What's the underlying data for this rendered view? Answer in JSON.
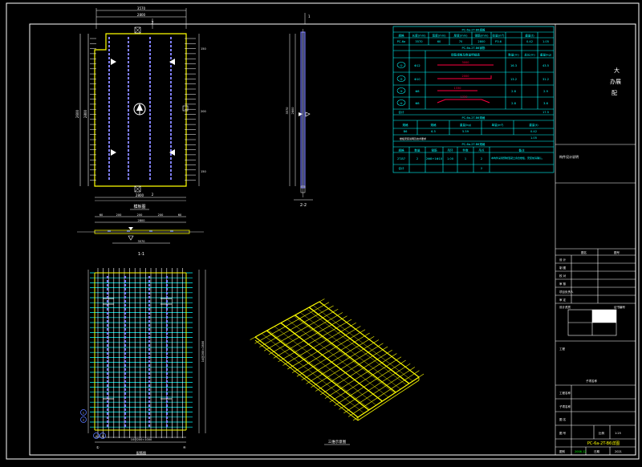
{
  "colors": {
    "background": "#000000",
    "frame": "#ffffff",
    "yellow": "#ffff00",
    "cyan": "#00ffff",
    "blue": "#5a78ff",
    "purple": "#8080ff",
    "red": "#ff0040",
    "magenta": "#ff00ff",
    "green": "#00ff00"
  },
  "table": {
    "title1": "PC-6a-2T-B6规格",
    "title2": "PC-6a-2T-B6钢筋",
    "title3": "PC-6a-2T-B6规格",
    "title4": "PC-6a-2T-B6规格",
    "header_row": [
      "规格",
      "长度(mm)",
      "宽度(mm)",
      "厚度(mm)",
      "钢筋(mm)",
      "砼量(m³)",
      "重量(t)"
    ],
    "spec_row": [
      "PC-6a",
      "3570",
      "60",
      "70",
      "2800",
      "P3.6",
      "0.42",
      "1.05"
    ],
    "rebar_header": "钢筋规格及数量明细表",
    "rebar_rows": [
      {
        "id": "①",
        "spec": "Φ12",
        "len": "3000",
        "n": "16.3",
        "w": "43.5"
      },
      {
        "id": "②",
        "spec": "Φ10",
        "len": "2000",
        "n": "13.2",
        "w": "31.2"
      },
      {
        "id": "③",
        "spec": "Φ8",
        "len": "1330",
        "n": "2.8",
        "w": "2.9"
      },
      {
        "id": "④",
        "spec": "Φ8",
        "len": "1330",
        "n": "2.8",
        "w": "3.6"
      }
    ],
    "sum_label": "合计",
    "sum_value": "17.5",
    "mid_row_labels": [
      "规格",
      "规格",
      "重量(kg)",
      "单量(m³)",
      "重量(t)"
    ],
    "mid_row_values": [
      "B6",
      "6.5",
      "5.59",
      "0.42"
    ],
    "mid_row_values2": [
      "",
      "",
      "",
      "1.05"
    ],
    "bottom_header": [
      "规格",
      "数量",
      "钢筋",
      "吊环",
      "件数",
      "吊点",
      "备注"
    ],
    "bottom_row": [
      "2T-B7",
      "2",
      "2Φ8+1Φ10",
      "1.00",
      "1",
      "2"
    ],
    "bottom_sum": [
      "合计",
      "",
      "",
      "",
      "",
      "2"
    ],
    "note_text": "本构件采用预制混凝土叠合楼板，安装前请确认。"
  },
  "side_note": "楼板安装说明及技术要求",
  "side_note2": "构件设计说明",
  "title_big": "大",
  "title_big2": "办展",
  "title_big3": "配",
  "title_block": {
    "rows": [
      "设 计",
      "制 图",
      "校 对",
      "审 核",
      "项目负责人",
      "审 定"
    ],
    "col_labels": [
      "图名",
      "图号"
    ],
    "company_label": "工程",
    "project_label": "子项名称",
    "scale_label": "比例",
    "scale_value": "1:25",
    "sheet_label": "图别",
    "date_label": "日期",
    "drawing_no": "PC-6a-2T-B6详图",
    "bottom_left": "2008.12",
    "bottom_right": "2021",
    "small_top": "设计资质",
    "small_top2": "证书编号"
  },
  "views": {
    "plan_label": "模板图",
    "section11": "1-1",
    "section22": "2-2",
    "rebar_label": "配筋图",
    "iso_label": "三维示意图",
    "dims_top": [
      "3570",
      "2800"
    ],
    "dims_bottom": [
      "2800",
      "3570"
    ],
    "dims_side_left": [
      "2600",
      "2800"
    ],
    "dims_mid": [
      "60",
      "200",
      "200",
      "200",
      "60"
    ],
    "dim_rebar_bottom": "10@200=1000",
    "dim_rebar_side": "14@200=2800",
    "marks": [
      "1",
      "2",
      "3",
      "4"
    ]
  }
}
